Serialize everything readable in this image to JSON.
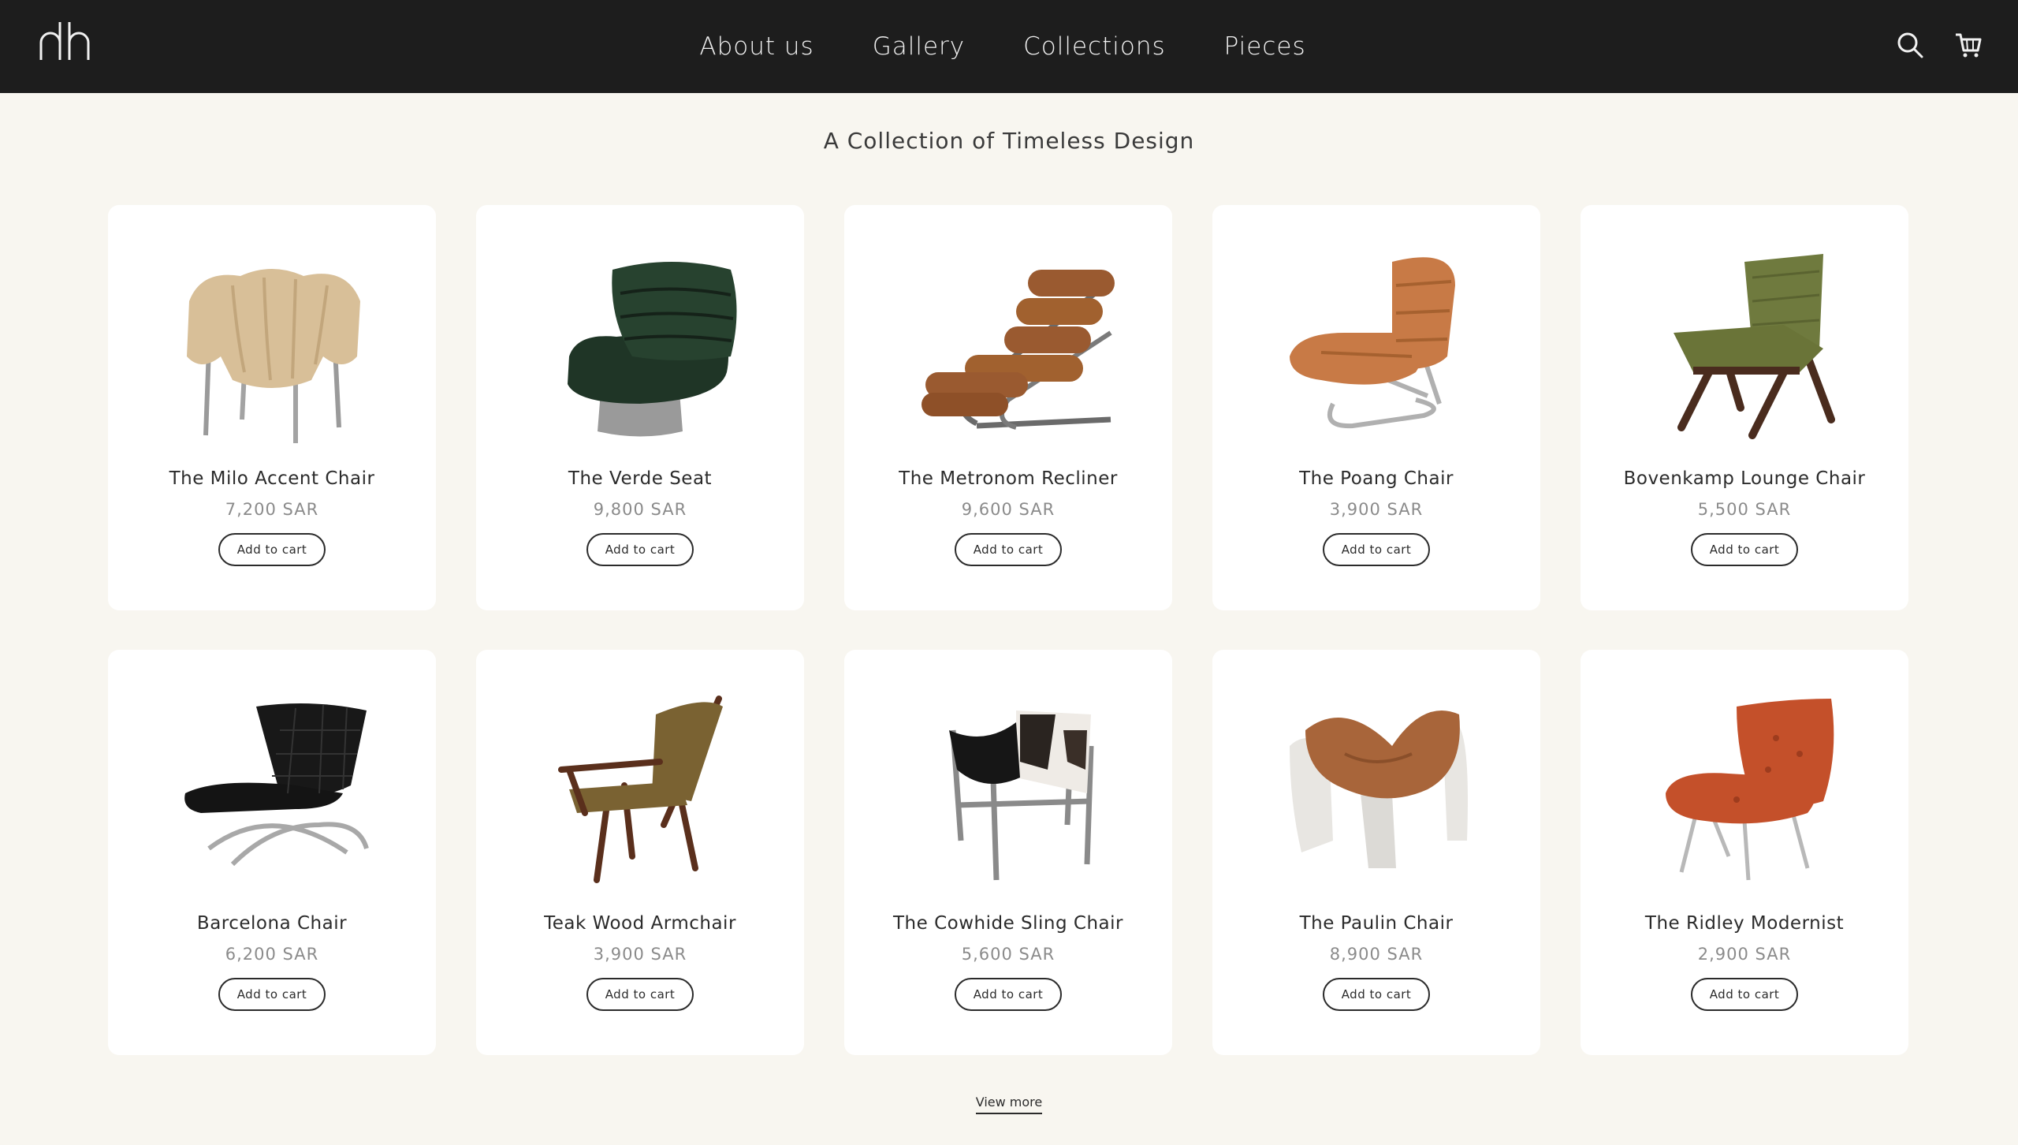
{
  "nav": {
    "links": [
      "About us",
      "Gallery",
      "Collections",
      "Pieces"
    ],
    "icons": [
      "search-icon",
      "cart-icon"
    ]
  },
  "page": {
    "title": "A Collection of Timeless Design",
    "view_more": "View more"
  },
  "products": [
    {
      "name": "The Milo Accent Chair",
      "price": "7,200 SAR",
      "button": "Add to cart",
      "color": "#d8bf98"
    },
    {
      "name": "The Verde Seat",
      "price": "9,800 SAR",
      "button": "Add to cart",
      "color": "#1f3526"
    },
    {
      "name": "The Metronom Recliner",
      "price": "9,600 SAR",
      "button": "Add to cart",
      "color": "#9a5a30"
    },
    {
      "name": "The Poang Chair",
      "price": "3,900 SAR",
      "button": "Add to cart",
      "color": "#c87a46"
    },
    {
      "name": "Bovenkamp Lounge Chair",
      "price": "5,500 SAR",
      "button": "Add to cart",
      "color": "#6f7a3e"
    },
    {
      "name": "Barcelona Chair",
      "price": "6,200 SAR",
      "button": "Add to cart",
      "color": "#161616"
    },
    {
      "name": "Teak Wood Armchair",
      "price": "3,900 SAR",
      "button": "Add to cart",
      "color": "#7a6232"
    },
    {
      "name": "The Cowhide Sling Chair",
      "price": "5,600 SAR",
      "button": "Add to cart",
      "color": "#2a2420"
    },
    {
      "name": "The Paulin Chair",
      "price": "8,900 SAR",
      "button": "Add to cart",
      "color": "#a8653a"
    },
    {
      "name": "The Ridley Modernist",
      "price": "2,900 SAR",
      "button": "Add to cart",
      "color": "#c4502a"
    }
  ]
}
